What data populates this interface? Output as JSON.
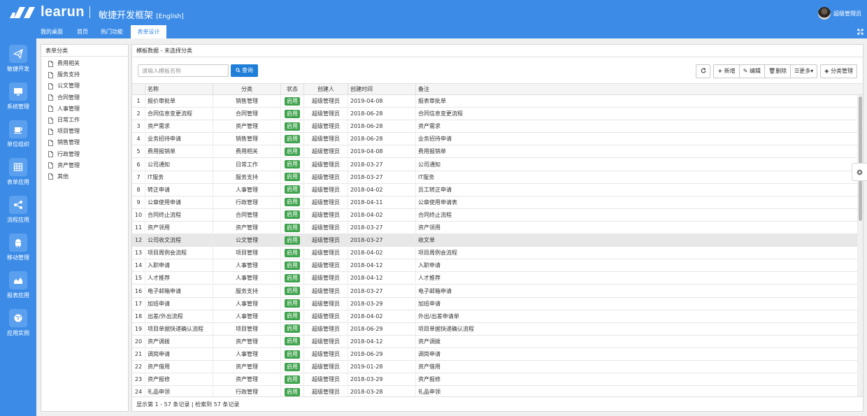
{
  "header": {
    "logo_text": "learun",
    "subtitle": "敏捷开发框架",
    "lang_link": "[English]",
    "user_name": "超级管理员"
  },
  "tabs": [
    {
      "label": "我的桌面",
      "active": false
    },
    {
      "label": "首页",
      "active": false
    },
    {
      "label": "热门功能",
      "active": false
    },
    {
      "label": "表单设计",
      "active": true
    }
  ],
  "sidebar": {
    "items": [
      {
        "label": "敏捷开发",
        "icon": "paper-plane-icon"
      },
      {
        "label": "系统管理",
        "icon": "desktop-icon"
      },
      {
        "label": "单位组织",
        "icon": "coffee-icon"
      },
      {
        "label": "表单应用",
        "icon": "table-icon"
      },
      {
        "label": "流程应用",
        "icon": "share-icon"
      },
      {
        "label": "移动管理",
        "icon": "android-icon"
      },
      {
        "label": "报表应用",
        "icon": "area-chart-icon"
      },
      {
        "label": "应用实例",
        "icon": "globe-icon"
      }
    ]
  },
  "category_panel": {
    "title": "表单分类",
    "items": [
      "费用相关",
      "服务支持",
      "公文管理",
      "合同管理",
      "人事管理",
      "日常工作",
      "项目管理",
      "销售管理",
      "行政管理",
      "资产管理",
      "其他"
    ]
  },
  "data_panel": {
    "title": "模板数据 - 未选择分类",
    "search_placeholder": "请输入模板名称",
    "query_label": "查询",
    "toolbar": {
      "refresh_icon": "refresh-icon",
      "add_label": "新增",
      "edit_label": "编辑",
      "delete_label": "删除",
      "more_label": "更多",
      "category_label": "分类管理"
    },
    "columns": [
      "名称",
      "分类",
      "状态",
      "创建人",
      "创建时间",
      "备注"
    ],
    "status_color": "#3fa34d",
    "accent_color": "#3c8ce7",
    "selected_row": 12,
    "rows": [
      {
        "no": "1",
        "name": "报价审批单",
        "category": "销售管理",
        "status": "启用",
        "creator": "超级管理员",
        "created": "2019-04-08",
        "remark": "报表审批单"
      },
      {
        "no": "2",
        "name": "合同信息变更流程",
        "category": "合同管理",
        "status": "启用",
        "creator": "超级管理员",
        "created": "2018-06-28",
        "remark": "合同信息变更流程"
      },
      {
        "no": "3",
        "name": "资产需求",
        "category": "资产管理",
        "status": "启用",
        "creator": "超级管理员",
        "created": "2018-06-28",
        "remark": "资产需求"
      },
      {
        "no": "4",
        "name": "业务招待申请",
        "category": "销售管理",
        "status": "启用",
        "creator": "超级管理员",
        "created": "2018-06-28",
        "remark": "业务招待申请"
      },
      {
        "no": "5",
        "name": "费用报销单",
        "category": "费用相关",
        "status": "启用",
        "creator": "超级管理员",
        "created": "2019-04-08",
        "remark": "费用报销单"
      },
      {
        "no": "6",
        "name": "公司通知",
        "category": "日常工作",
        "status": "启用",
        "creator": "超级管理员",
        "created": "2018-03-27",
        "remark": "公司通知"
      },
      {
        "no": "7",
        "name": "IT服务",
        "category": "服务支持",
        "status": "启用",
        "creator": "超级管理员",
        "created": "2018-03-27",
        "remark": "IT服务"
      },
      {
        "no": "8",
        "name": "转正申请",
        "category": "人事管理",
        "status": "启用",
        "creator": "超级管理员",
        "created": "2018-04-02",
        "remark": "员工转正申请"
      },
      {
        "no": "9",
        "name": "公章使用申请",
        "category": "行政管理",
        "status": "启用",
        "creator": "超级管理员",
        "created": "2018-04-11",
        "remark": "公章使用申请表"
      },
      {
        "no": "10",
        "name": "合同终止流程",
        "category": "合同管理",
        "status": "启用",
        "creator": "超级管理员",
        "created": "2018-04-02",
        "remark": "合同终止流程"
      },
      {
        "no": "11",
        "name": "资产领用",
        "category": "资产管理",
        "status": "启用",
        "creator": "超级管理员",
        "created": "2018-03-27",
        "remark": "资产领用"
      },
      {
        "no": "12",
        "name": "公司收文流程",
        "category": "公文管理",
        "status": "启用",
        "creator": "超级管理员",
        "created": "2018-03-27",
        "remark": "收文单"
      },
      {
        "no": "13",
        "name": "项目周例会流程",
        "category": "项目管理",
        "status": "启用",
        "creator": "超级管理员",
        "created": "2018-04-02",
        "remark": "项目周例会流程"
      },
      {
        "no": "14",
        "name": "入职申请",
        "category": "人事管理",
        "status": "启用",
        "creator": "超级管理员",
        "created": "2018-04-12",
        "remark": "入职申请"
      },
      {
        "no": "15",
        "name": "人才推荐",
        "category": "人事管理",
        "status": "启用",
        "creator": "超级管理员",
        "created": "2018-04-12",
        "remark": "人才推荐"
      },
      {
        "no": "16",
        "name": "电子邮箱申请",
        "category": "服务支持",
        "status": "启用",
        "creator": "超级管理员",
        "created": "2018-03-27",
        "remark": "电子邮箱申请"
      },
      {
        "no": "17",
        "name": "加班申请",
        "category": "人事管理",
        "status": "启用",
        "creator": "超级管理员",
        "created": "2018-03-29",
        "remark": "加班申请"
      },
      {
        "no": "18",
        "name": "出差/外出流程",
        "category": "人事管理",
        "status": "启用",
        "creator": "超级管理员",
        "created": "2018-04-02",
        "remark": "外出/出差申请单"
      },
      {
        "no": "19",
        "name": "项目单据快递确认流程",
        "category": "项目管理",
        "status": "启用",
        "creator": "超级管理员",
        "created": "2018-06-29",
        "remark": "项目单据快递确认流程"
      },
      {
        "no": "20",
        "name": "资产调拨",
        "category": "资产管理",
        "status": "启用",
        "creator": "超级管理员",
        "created": "2018-04-12",
        "remark": "资产调拨"
      },
      {
        "no": "21",
        "name": "调岗申请",
        "category": "人事管理",
        "status": "启用",
        "creator": "超级管理员",
        "created": "2018-06-29",
        "remark": "调岗申请"
      },
      {
        "no": "22",
        "name": "资产借用",
        "category": "资产管理",
        "status": "启用",
        "creator": "超级管理员",
        "created": "2019-01-28",
        "remark": "资产借用"
      },
      {
        "no": "23",
        "name": "资产报修",
        "category": "资产管理",
        "status": "启用",
        "creator": "超级管理员",
        "created": "2018-03-29",
        "remark": "资产报修"
      },
      {
        "no": "24",
        "name": "礼品申领",
        "category": "行政管理",
        "status": "启用",
        "creator": "超级管理员",
        "created": "2018-03-28",
        "remark": "礼品申领"
      }
    ],
    "footer": "显示第 1 - 57 条记录 | 检索到 57 条记录"
  }
}
